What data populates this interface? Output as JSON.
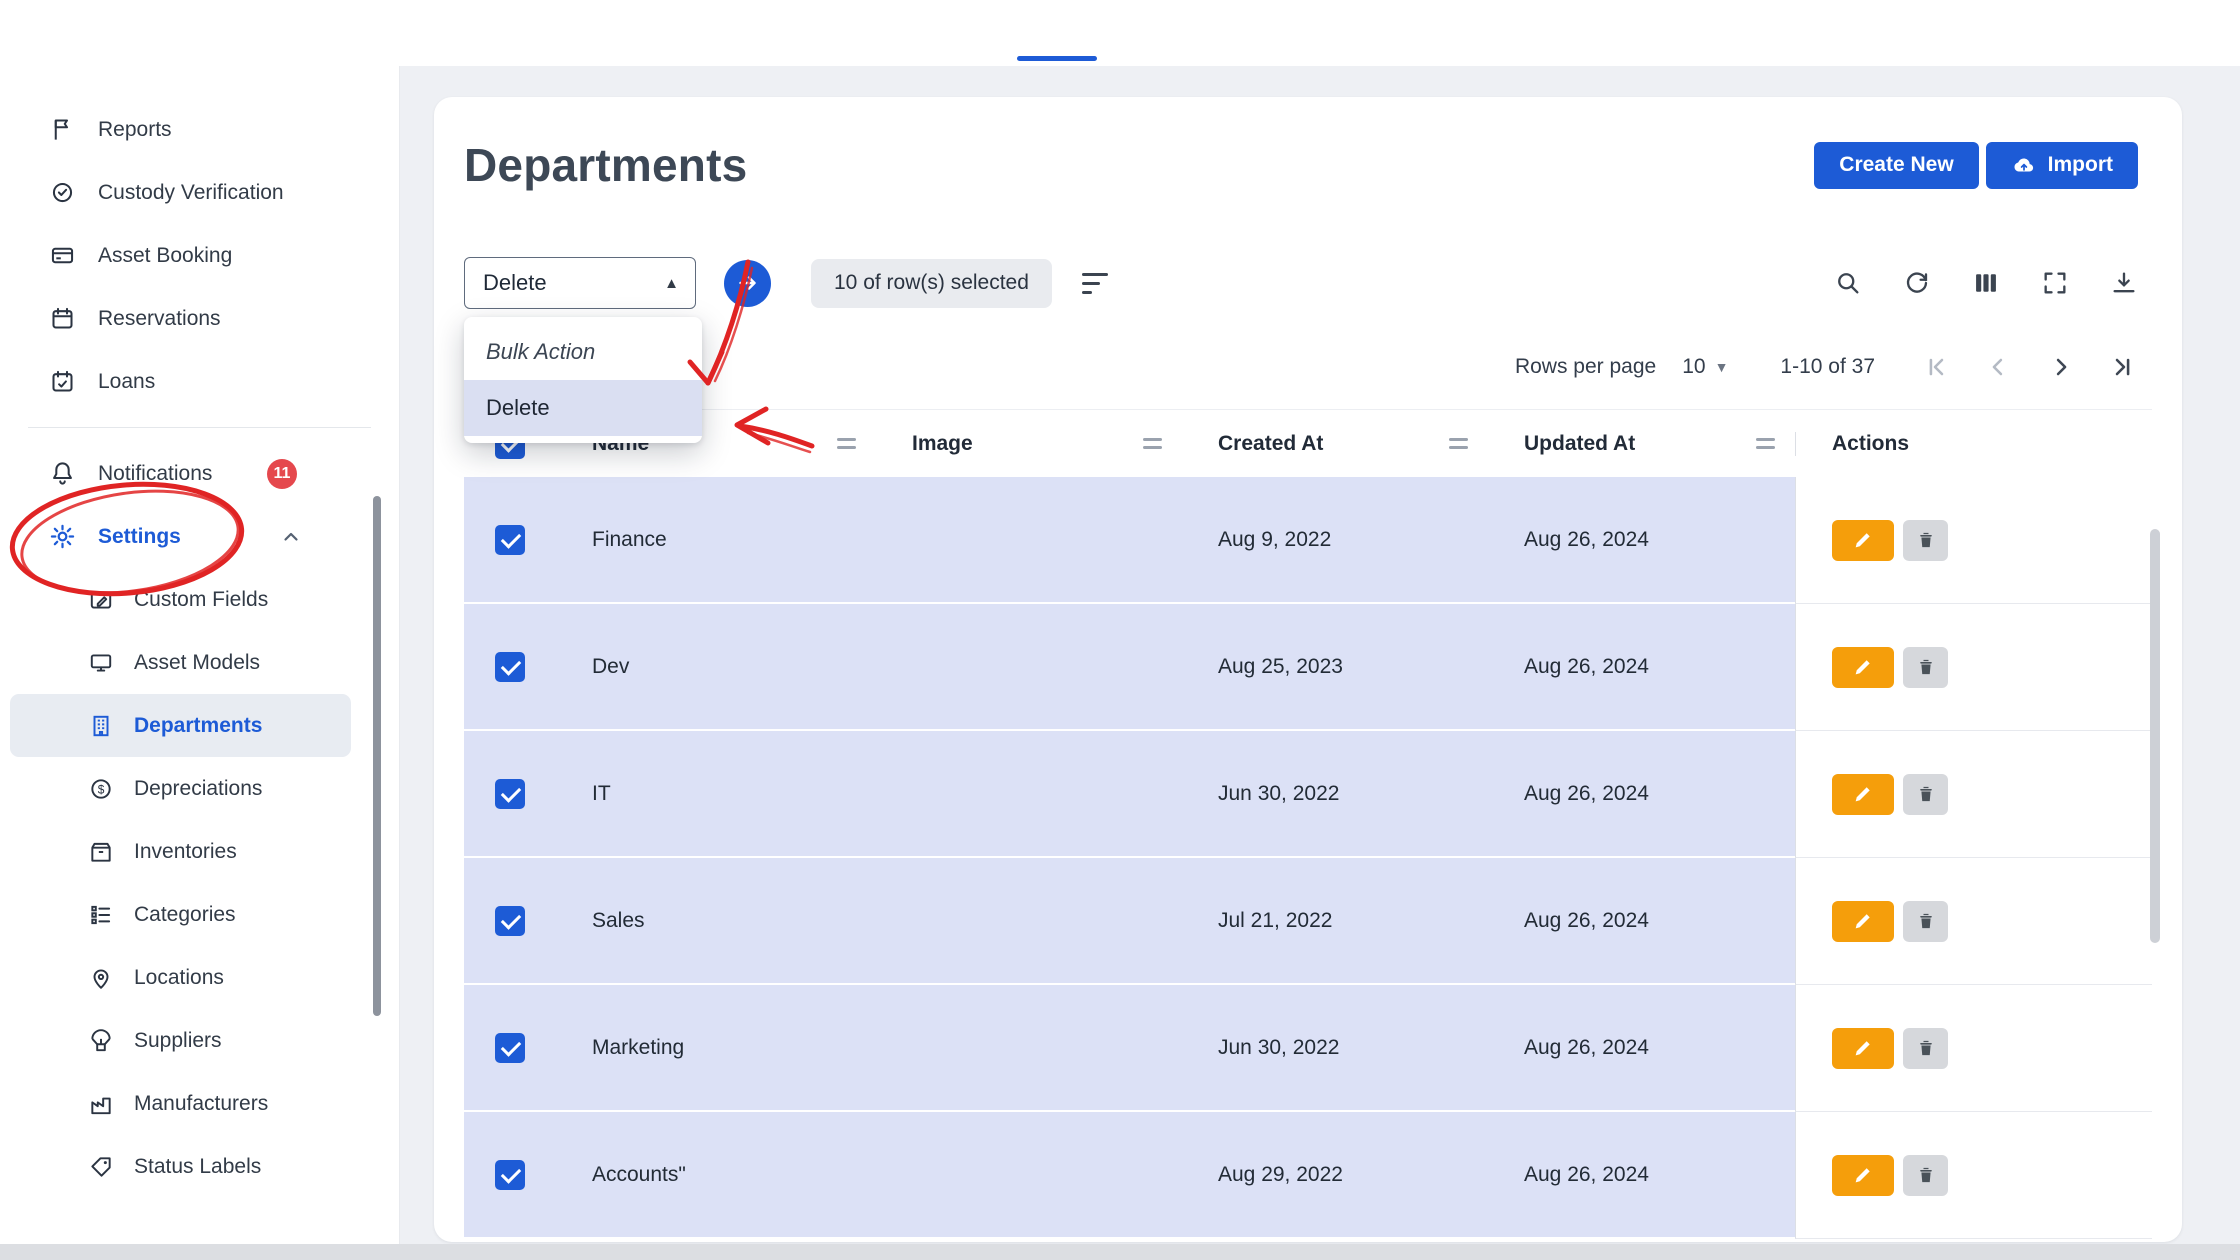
{
  "colors": {
    "accent": "#1d5bd6",
    "selected_row": "#dce1f6",
    "edit_orange": "#f59e0b",
    "badge_red": "#e5484d",
    "annotation_red": "#e02424"
  },
  "sidebar": {
    "top_items": [
      {
        "label": "Reports"
      },
      {
        "label": "Custody Verification"
      },
      {
        "label": "Asset Booking"
      },
      {
        "label": "Reservations"
      },
      {
        "label": "Loans"
      }
    ],
    "notifications": {
      "label": "Notifications",
      "badge": "11"
    },
    "settings": {
      "label": "Settings"
    },
    "settings_items": [
      {
        "label": "Custom Fields"
      },
      {
        "label": "Asset Models"
      },
      {
        "label": "Departments"
      },
      {
        "label": "Depreciations"
      },
      {
        "label": "Inventories"
      },
      {
        "label": "Categories"
      },
      {
        "label": "Locations"
      },
      {
        "label": "Suppliers"
      },
      {
        "label": "Manufacturers"
      },
      {
        "label": "Status Labels"
      }
    ]
  },
  "header": {
    "title": "Departments",
    "create_label": "Create New",
    "import_label": "Import"
  },
  "toolbar": {
    "select_value": "Delete",
    "selected_chip": "10 of row(s) selected"
  },
  "menu": {
    "items": [
      {
        "label": "Bulk Action"
      },
      {
        "label": "Delete"
      }
    ]
  },
  "pagination": {
    "rows_per_page_label": "Rows per page",
    "rows_per_page_value": "10",
    "range": "1-10 of 37"
  },
  "table": {
    "columns": [
      "Name",
      "Image",
      "Created At",
      "Updated At",
      "Actions"
    ],
    "rows": [
      {
        "name": "Finance",
        "image": "",
        "created_at": "Aug 9, 2022",
        "updated_at": "Aug 26, 2024"
      },
      {
        "name": "Dev",
        "image": "",
        "created_at": "Aug 25, 2023",
        "updated_at": "Aug 26, 2024"
      },
      {
        "name": "IT",
        "image": "",
        "created_at": "Jun 30, 2022",
        "updated_at": "Aug 26, 2024"
      },
      {
        "name": "Sales",
        "image": "",
        "created_at": "Jul 21, 2022",
        "updated_at": "Aug 26, 2024"
      },
      {
        "name": "Marketing",
        "image": "",
        "created_at": "Jun 30, 2022",
        "updated_at": "Aug 26, 2024"
      },
      {
        "name": "Accounts\"",
        "image": "",
        "created_at": "Aug 29, 2022",
        "updated_at": "Aug 26, 2024"
      }
    ]
  }
}
